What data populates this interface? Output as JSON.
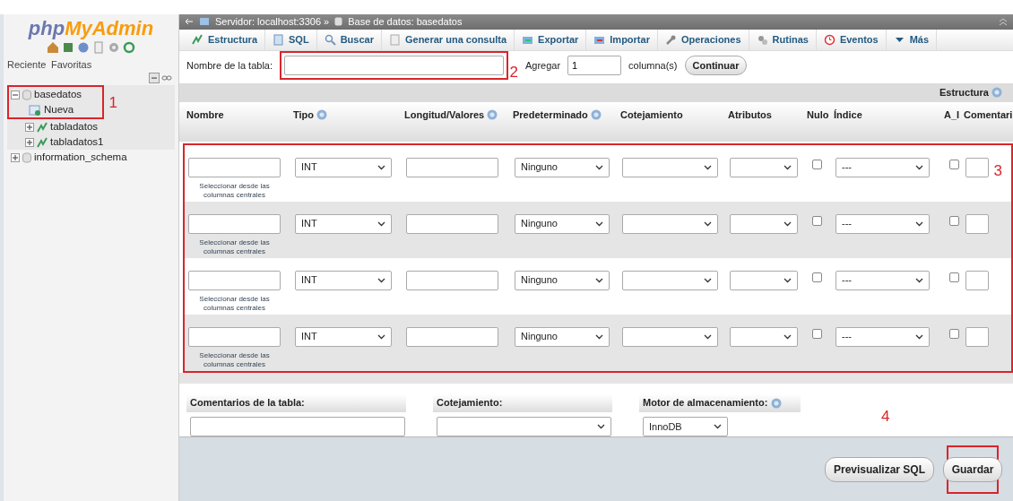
{
  "sidebar": {
    "logo_part1": "php",
    "logo_part2": "MyAdmin",
    "links": [
      "Reciente",
      "Favoritas"
    ],
    "tree": [
      {
        "label": "basedatos",
        "expanded": true,
        "children": [
          {
            "label": "Nueva",
            "kind": "new"
          },
          {
            "label": "tabladatos",
            "kind": "table"
          },
          {
            "label": "tabladatos1",
            "kind": "table"
          }
        ]
      },
      {
        "label": "information_schema",
        "expanded": false
      }
    ]
  },
  "breadcrumb": {
    "server": "Servidor: localhost:3306 »",
    "database": "Base de datos: basedatos"
  },
  "tabs": [
    {
      "label": "Estructura",
      "kind": "structure"
    },
    {
      "label": "SQL",
      "kind": "sql"
    },
    {
      "label": "Buscar",
      "kind": "search"
    },
    {
      "label": "Generar una consulta",
      "kind": "query"
    },
    {
      "label": "Exportar",
      "kind": "export"
    },
    {
      "label": "Importar",
      "kind": "import"
    },
    {
      "label": "Operaciones",
      "kind": "wrench"
    },
    {
      "label": "Rutinas",
      "kind": "routines"
    },
    {
      "label": "Eventos",
      "kind": "clock"
    },
    {
      "label": "Más",
      "kind": "caret"
    }
  ],
  "table_name": {
    "label": "Nombre de la tabla:",
    "add_label": "Agregar",
    "add_value": "1",
    "columns_label": "columna(s)",
    "button": "Continuar"
  },
  "structure_label": "Estructura",
  "columns": [
    {
      "label": "Nombre",
      "help": false
    },
    {
      "label": "Tipo",
      "help": true
    },
    {
      "label": "Longitud/Valores",
      "help": true
    },
    {
      "label": "Predeterminado",
      "help": true
    },
    {
      "label": "Cotejamiento",
      "help": false
    },
    {
      "label": "Atributos",
      "help": false
    },
    {
      "label": "Nulo",
      "help": false
    },
    {
      "label": "Índice",
      "help": false
    },
    {
      "label": "A_I",
      "help": false
    },
    {
      "label": "Comentari",
      "help": false
    }
  ],
  "rows": [
    {
      "type": "INT",
      "default": "Ninguno",
      "null_checked": false,
      "index": "---",
      "ai_checked": false,
      "link": "Seleccionar desde las columnas centrales"
    },
    {
      "type": "INT",
      "default": "Ninguno",
      "null_checked": false,
      "index": "---",
      "ai_checked": false,
      "link": "Seleccionar desde las columnas centrales"
    },
    {
      "type": "INT",
      "default": "Ninguno",
      "null_checked": false,
      "index": "---",
      "ai_checked": false,
      "link": "Seleccionar desde las columnas centrales"
    },
    {
      "type": "INT",
      "default": "Ninguno",
      "null_checked": false,
      "index": "---",
      "ai_checked": false,
      "link": "Seleccionar desde las columnas centrales"
    }
  ],
  "table_options": {
    "comments_label": "Comentarios de la tabla:",
    "collation_label": "Cotejamiento:",
    "engine_label": "Motor de almacenamiento:",
    "engine": "InnoDB"
  },
  "buttons": [
    "Previsualizar SQL",
    "Guardar"
  ],
  "annotations": [
    {
      "label": "1"
    },
    {
      "label": "2"
    },
    {
      "label": "3"
    },
    {
      "label": "4"
    }
  ]
}
